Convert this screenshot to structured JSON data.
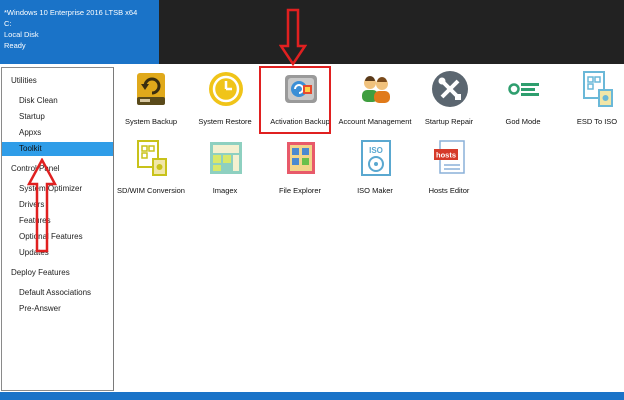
{
  "header": {
    "title": "*Windows 10 Enterprise 2016 LTSB x64",
    "drive": "C:",
    "disk_type": "Local Disk",
    "status": "Ready"
  },
  "sidebar": {
    "sections": [
      {
        "label": "Utilities"
      },
      {
        "label": "Control Panel"
      },
      {
        "label": "Deploy Features"
      }
    ],
    "utilities_items": [
      "Disk Clean",
      "Startup",
      "Appxs",
      "Toolkit"
    ],
    "control_panel_items": [
      "System Optimizer",
      "Drivers",
      "Features",
      "Optional Features",
      "Updates"
    ],
    "deploy_items": [
      "Default Associations",
      "Pre-Answer"
    ],
    "selected": "Toolkit"
  },
  "tools": {
    "row1": [
      {
        "label": "System Backup",
        "icon": "disk-backup-icon"
      },
      {
        "label": "System Restore",
        "icon": "clock-restore-icon"
      },
      {
        "label": "Activation Backup",
        "icon": "activation-backup-icon"
      },
      {
        "label": "Account Management",
        "icon": "users-icon"
      },
      {
        "label": "Startup Repair",
        "icon": "tools-repair-icon"
      },
      {
        "label": "God Mode",
        "icon": "god-mode-icon"
      },
      {
        "label": "ESD To ISO",
        "icon": "esd-to-iso-icon"
      }
    ],
    "row2": [
      {
        "label": "SD/WIM Conversion",
        "icon": "wim-conversion-icon"
      },
      {
        "label": "Imagex",
        "icon": "imagex-icon"
      },
      {
        "label": "File Explorer",
        "icon": "file-explorer-icon"
      },
      {
        "label": "ISO Maker",
        "icon": "iso-maker-icon"
      },
      {
        "label": "Hosts Editor",
        "icon": "hosts-editor-icon"
      }
    ]
  },
  "icon_text": {
    "iso": "ISO",
    "hosts": "hosts"
  },
  "colors": {
    "header_blue": "#1a73c8",
    "header_dark": "#222222",
    "selection_blue": "#2f9de8",
    "annotation_red": "#e02020"
  }
}
